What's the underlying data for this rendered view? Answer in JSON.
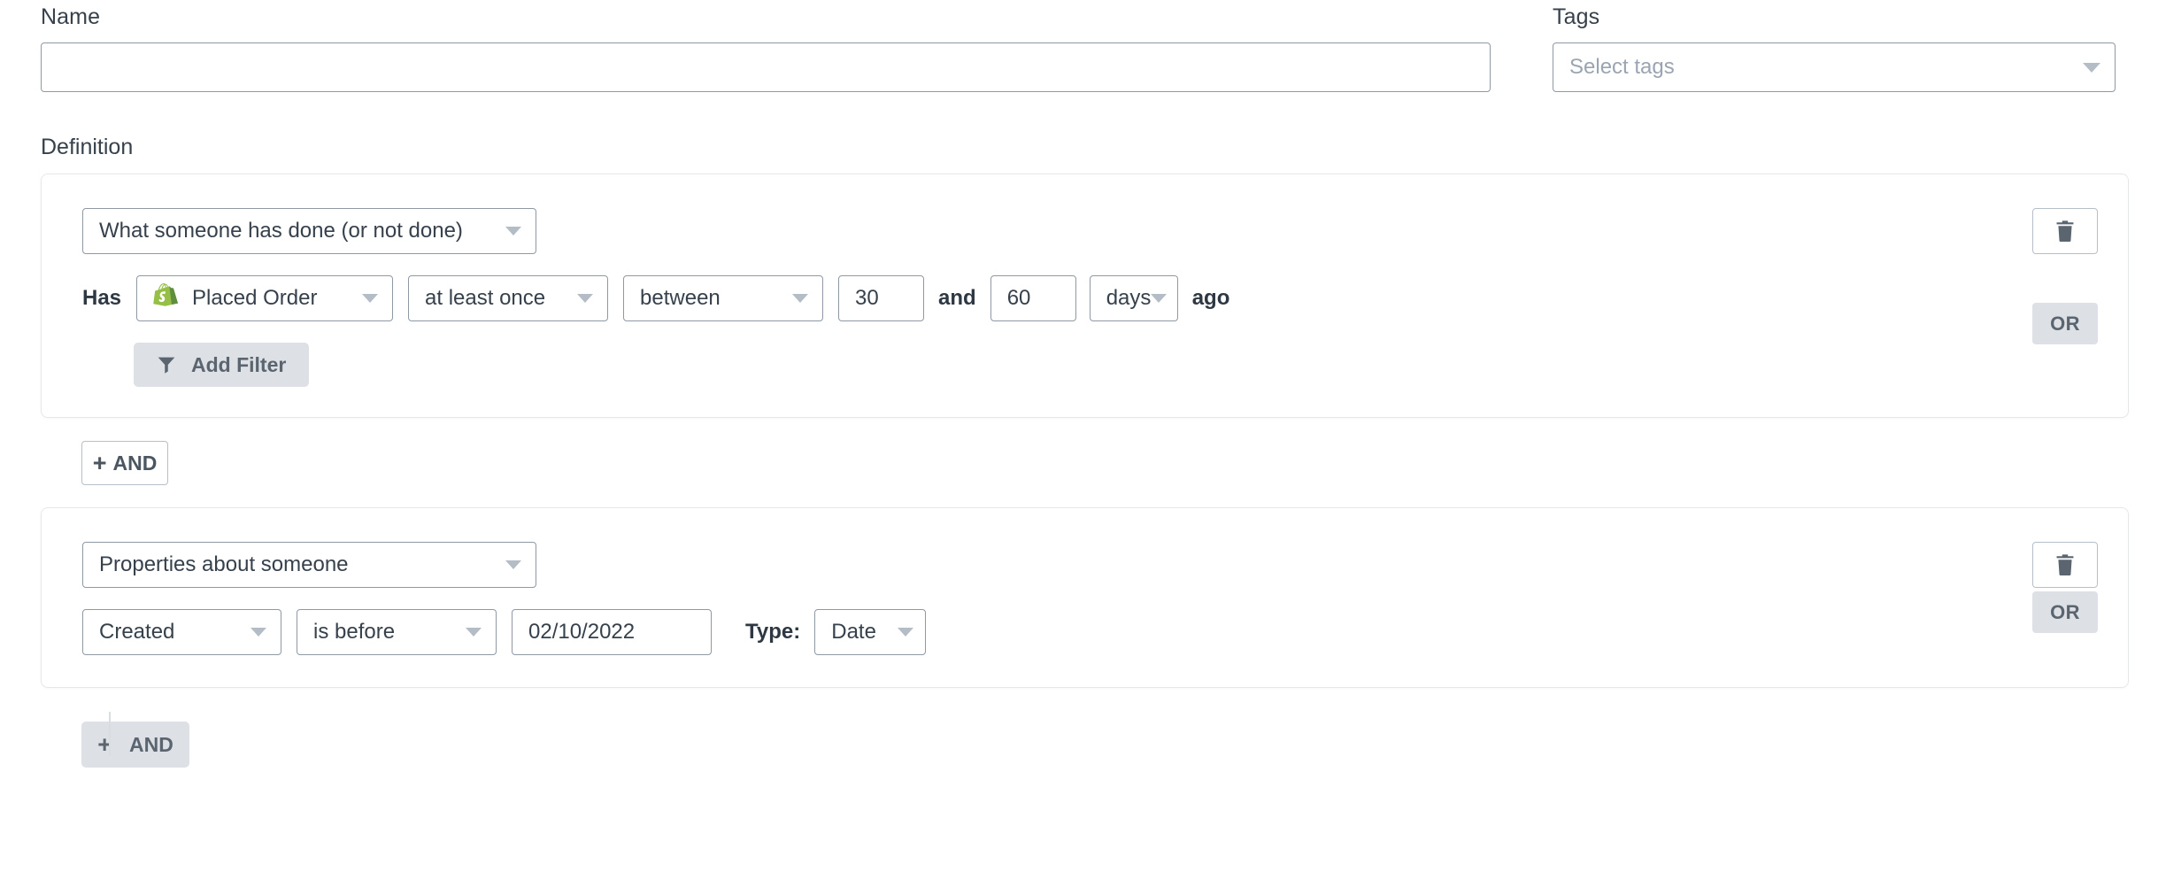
{
  "form": {
    "name": {
      "label": "Name",
      "value": "",
      "placeholder": ""
    },
    "tags": {
      "label": "Tags",
      "placeholder": "Select tags",
      "value": ""
    }
  },
  "definition": {
    "label": "Definition",
    "groups": [
      {
        "type_select": "What someone has done (or not done)",
        "delete_label": "",
        "or_label": "OR",
        "condition": {
          "prefix_label": "Has",
          "metric": "Placed Order",
          "metric_icon": "shopify-icon",
          "frequency": "at least once",
          "timeframe": "between",
          "value_start": "30",
          "conjunction_label": "and",
          "value_end": "60",
          "unit": "days",
          "suffix_label": "ago"
        },
        "add_filter_label": "Add Filter",
        "add_filter_icon": "funnel-icon"
      },
      {
        "type_select": "Properties about someone",
        "delete_label": "",
        "or_label": "OR",
        "condition": {
          "property": "Created",
          "operator": "is before",
          "date_value": "02/10/2022",
          "type_label": "Type:",
          "type_value": "Date"
        }
      }
    ],
    "and_button_middle": "AND",
    "and_button_bottom": "AND",
    "plus_glyph": "+"
  },
  "colors": {
    "accent_grey": "#dde1e5",
    "border_grey": "#8f99a3",
    "text_dark": "#36414c",
    "shopify_green": "#95bf47",
    "shopify_green_dark": "#5e8e3e"
  }
}
